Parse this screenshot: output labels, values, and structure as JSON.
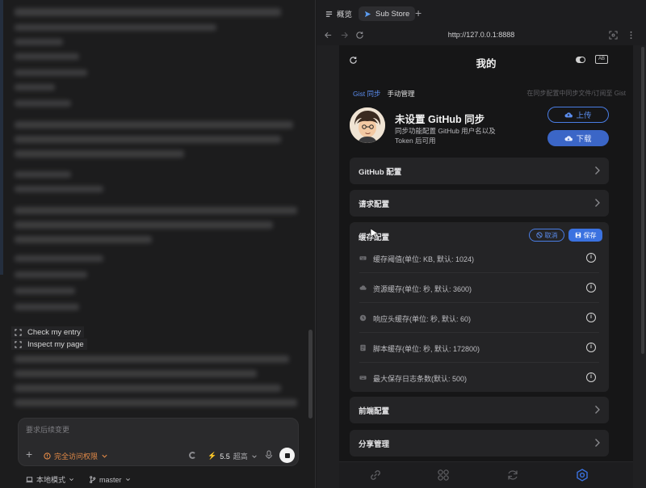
{
  "left_pane": {
    "hints": [
      {
        "label": "Check my entry"
      },
      {
        "label": "Inspect my page"
      }
    ],
    "composer": {
      "placeholder": "要求后续变更",
      "permission_label": "完全访问权限",
      "model_version": "5.5",
      "model_quality": "超高"
    },
    "footer": {
      "mode_label": "本地模式",
      "branch_label": "master"
    }
  },
  "browser": {
    "tabs": [
      {
        "label": "概览",
        "icon": "list-icon"
      },
      {
        "label": "Sub Store",
        "icon": "paper-plane-icon",
        "active": true
      }
    ],
    "url": "http://127.0.0.1:8888"
  },
  "app": {
    "title": "我的",
    "subtabs": [
      {
        "label": "Gist 同步",
        "active": true
      },
      {
        "label": "手动管理",
        "active": false
      }
    ],
    "sync_hint": "在同步配置中同步文件/订阅至 Gist",
    "github": {
      "title": "未设置 GitHub 同步",
      "desc_line1": "同步功能配置 GitHub 用户名以及",
      "desc_line2": "Token 后可用",
      "upload_label": "上传",
      "download_label": "下载"
    },
    "sections": [
      {
        "label": "GitHub 配置"
      },
      {
        "label": "请求配置"
      }
    ],
    "cache": {
      "title": "缓存配置",
      "cancel_label": "取消",
      "save_label": "保存",
      "items": [
        {
          "label": "缓存阈值(单位: KB, 默认: 1024)",
          "icon": "keyboard-icon"
        },
        {
          "label": "资源缓存(单位: 秒, 默认: 3600)",
          "icon": "cloud-icon"
        },
        {
          "label": "响应头缓存(单位: 秒, 默认: 60)",
          "icon": "clock-icon"
        },
        {
          "label": "脚本缓存(单位: 秒, 默认: 172800)",
          "icon": "script-icon"
        },
        {
          "label": "最大保存日志条数(默认: 500)",
          "icon": "keyboard-icon"
        }
      ]
    },
    "sections_bottom": [
      {
        "label": "前端配置"
      },
      {
        "label": "分享管理"
      }
    ],
    "bottom_nav": [
      {
        "name": "link-icon"
      },
      {
        "name": "apps-icon"
      },
      {
        "name": "sync-icon"
      },
      {
        "name": "settings-icon",
        "active": true
      }
    ],
    "colors": {
      "accent": "#3b72e0",
      "accent_text": "#5b8def",
      "warning": "#e38a47",
      "background": "#161617",
      "card": "#242426"
    }
  }
}
